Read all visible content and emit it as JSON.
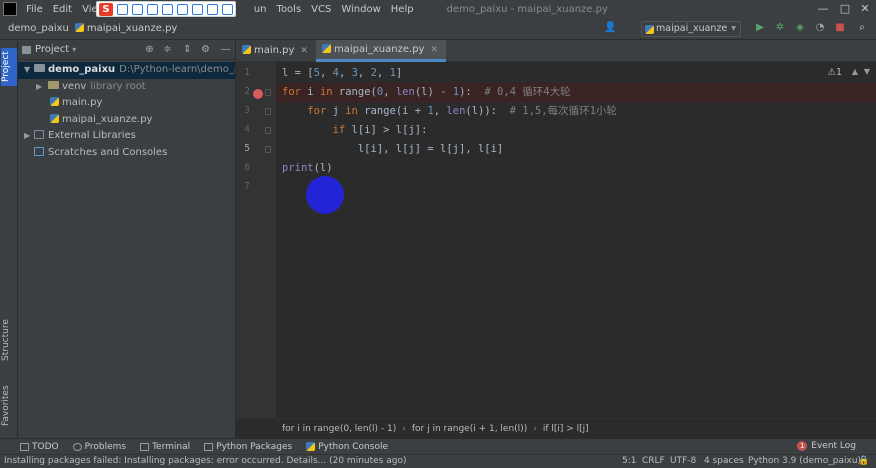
{
  "menubar": {
    "items": [
      "File",
      "Edit",
      "View",
      "un",
      "Tools",
      "VCS",
      "Window",
      "Help"
    ],
    "window_title": "demo_paixu - maipai_xuanze.py",
    "ime_logo": "S"
  },
  "navbar": {
    "project": "demo_paixu",
    "file": "maipai_xuanze.py",
    "run_config": "maipai_xuanze"
  },
  "left_stripe": {
    "project_tab": "Project",
    "structure_tab": "Structure",
    "favorites_tab": "Favorites"
  },
  "project_panel": {
    "header_label": "Project",
    "tree": [
      {
        "label": "demo_paixu",
        "path": "D:\\Python-learn\\demo_paixu",
        "kind": "folder",
        "expanded": true
      },
      {
        "label": "venv",
        "path": "library root",
        "kind": "folder",
        "expanded": false
      },
      {
        "label": "main.py",
        "path": "",
        "kind": "py"
      },
      {
        "label": "maipai_xuanze.py",
        "path": "",
        "kind": "py"
      },
      {
        "label": "External Libraries",
        "path": "",
        "kind": "lib",
        "expanded": false
      },
      {
        "label": "Scratches and Consoles",
        "path": "",
        "kind": "scratch"
      }
    ]
  },
  "editor": {
    "tabs": [
      {
        "label": "main.py",
        "active": false
      },
      {
        "label": "maipai_xuanze.py",
        "active": true
      }
    ],
    "analysis_indicator": "⚠1",
    "line_numbers": [
      "1",
      "2",
      "3",
      "4",
      "5",
      "6",
      "7"
    ],
    "code": {
      "l1_var": "l",
      "l1_eq": " = [",
      "l1_nums": [
        "5",
        "4",
        "3",
        "2",
        "1"
      ],
      "l1_end": "]",
      "l2_for": "for",
      "l2_i": " i ",
      "l2_in": "in",
      "l2_range": " range",
      "l2_open": "(",
      "l2_zero": "0",
      "l2_mid": ", ",
      "l2_len": "len",
      "l2_tail": "(l) - ",
      "l2_one": "1",
      "l2_close": "):",
      "l2_comment": "  # 0,4 循环4大轮",
      "l3_indent": "    ",
      "l3_for": "for",
      "l3_j": " j ",
      "l3_in": "in",
      "l3_range": " range",
      "l3_mid": "(i + ",
      "l3_one": "1",
      "l3_comma": ", ",
      "l3_len": "len",
      "l3_close": "(l)):",
      "l3_comment": "  # 1,5,每次循环1小轮",
      "l4_indent": "        ",
      "l4_if": "if",
      "l4_rest": " l[i] > l[j]:",
      "l5_text": "            l[i], l[j] = l[j], l[i]",
      "l6_print": "print",
      "l6_rest": "(l)"
    },
    "breadcrumb": [
      "for i in range(0, len(l) - 1)",
      "for j in range(i + 1, len(l))",
      "if l[i] > l[j]"
    ]
  },
  "bottom_tools": {
    "items": [
      "TODO",
      "Problems",
      "Terminal",
      "Python Packages",
      "Python Console"
    ],
    "event_log": "Event Log",
    "event_badge": "1"
  },
  "status_bar": {
    "message": "Installing packages failed: Installing packages: error occurred. Details... (20 minutes ago)",
    "position": "5:1",
    "line_sep": "CRLF",
    "encoding": "UTF-8",
    "indent": "4 spaces",
    "interpreter": "Python 3.9 (demo_paixu)"
  },
  "colors": {
    "editor_bg": "#2b2b2b",
    "panel_bg": "#3c3f41",
    "keyword": "#cc7832",
    "number": "#6897bb",
    "comment": "#808080",
    "breakpoint": "#db5c5c",
    "accent_tab": "#4a88c7",
    "click_marker": "#2424e6"
  }
}
